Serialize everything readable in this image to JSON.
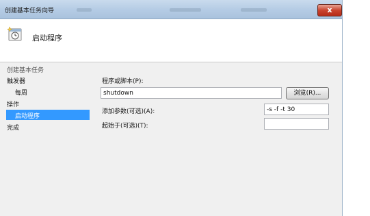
{
  "window": {
    "title": "创建基本任务向导",
    "close_label": "x"
  },
  "header": {
    "title": "启动程序",
    "icon": "task-scheduler-icon"
  },
  "nav": {
    "heading": "创建基本任务",
    "items": [
      {
        "label": "触发器"
      },
      {
        "label": "每周"
      },
      {
        "label": "操作"
      },
      {
        "label": "启动程序"
      },
      {
        "label": "完成"
      }
    ],
    "selected_color": "#3399ff"
  },
  "form": {
    "program_label": "程序或脚本(P):",
    "program_value": "shutdown",
    "browse_label": "浏览(R)...",
    "args_label": "添加参数(可选)(A):",
    "args_value": "-s -f -t 30",
    "start_in_label": "起始于(可选)(T):",
    "start_in_value": ""
  }
}
